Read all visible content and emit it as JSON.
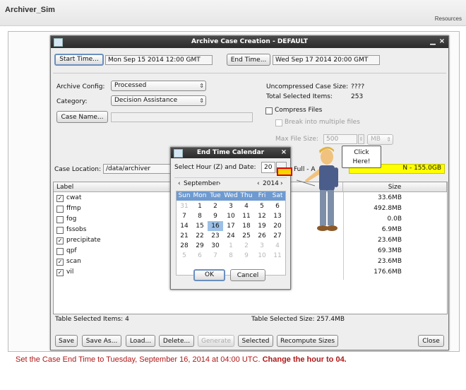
{
  "app": {
    "title": "Archiver_Sim",
    "resources_link": "Resources"
  },
  "window": {
    "title": "Archive Case Creation - DEFAULT",
    "close_symbol": "×"
  },
  "time_range": {
    "start_label": "Start Time...",
    "start_value": "Mon Sep 15 2014 12:00 GMT",
    "end_label": "End Time...",
    "end_value": "Wed Sep 17 2014 20:00 GMT"
  },
  "config": {
    "archive_config_label": "Archive Config:",
    "archive_config_value": "Processed",
    "category_label": "Category:",
    "category_value": "Decision Assistance",
    "case_name_button": "Case Name...",
    "case_name_value": ""
  },
  "summary": {
    "uncompressed_label": "Uncompressed Case Size:",
    "uncompressed_value": "????",
    "total_items_label": "Total Selected Items:",
    "total_items_value": "253",
    "compress_label": "Compress Files",
    "break_label": "Break into multiple files",
    "max_size_label": "Max File Size:",
    "max_size_value": "500",
    "max_size_unit": "MB"
  },
  "location": {
    "label": "Case Location:",
    "value": "/data/archiver",
    "status_prefix": "Full - A",
    "status_text": "N - 155.0GB"
  },
  "table": {
    "headers": {
      "label": "Label",
      "size": "Size"
    },
    "rows": [
      {
        "label": "cwat",
        "checked": true,
        "size": "33.6MB"
      },
      {
        "label": "ffmp",
        "checked": false,
        "size": "492.8MB"
      },
      {
        "label": "fog",
        "checked": false,
        "size": "0.0B"
      },
      {
        "label": "fssobs",
        "checked": false,
        "size": "6.9MB"
      },
      {
        "label": "precipitate",
        "checked": true,
        "size": "23.6MB"
      },
      {
        "label": "qpf",
        "checked": false,
        "size": "69.3MB"
      },
      {
        "label": "scan",
        "checked": true,
        "size": "23.6MB"
      },
      {
        "label": "vil",
        "checked": true,
        "size": "176.6MB"
      }
    ],
    "selected_items_label": "Table Selected Items: 4",
    "selected_size_label": "Table Selected Size: 257.4MB"
  },
  "toolbar": {
    "save": "Save",
    "save_as": "Save As...",
    "load": "Load...",
    "delete": "Delete...",
    "generate": "Generate",
    "selected": "Selected",
    "recompute": "Recompute Sizes",
    "close": "Close"
  },
  "calendar": {
    "title": "End Time Calendar",
    "hour_label": "Select Hour (Z) and Date:",
    "hour_value": "20",
    "month": "September",
    "year": "2014",
    "prev_symbol": "‹",
    "next_symbol": "›",
    "day_headers": [
      "Sun",
      "Mon",
      "Tue",
      "Wed",
      "Thu",
      "Fri",
      "Sat"
    ],
    "days": [
      [
        "31",
        "1",
        "2",
        "3",
        "4",
        "5",
        "6"
      ],
      [
        "7",
        "8",
        "9",
        "10",
        "11",
        "12",
        "13"
      ],
      [
        "14",
        "15",
        "16",
        "17",
        "18",
        "19",
        "20"
      ],
      [
        "21",
        "22",
        "23",
        "24",
        "25",
        "26",
        "27"
      ],
      [
        "28",
        "29",
        "30",
        "1",
        "2",
        "3",
        "4"
      ],
      [
        "5",
        "6",
        "7",
        "8",
        "9",
        "10",
        "11"
      ]
    ],
    "selected_day": "16",
    "ok": "OK",
    "cancel": "Cancel"
  },
  "callout": {
    "line1": "Click",
    "line2": "Here!"
  },
  "instruction": {
    "text": "Set the Case End Time to Tuesday, September 16, 2014 at 04:00 UTC.",
    "emphasis": "Change the hour to 04."
  },
  "colors": {
    "title_bar": "#2b2b2b",
    "calendar_header": "#6e9ad0",
    "selected_day": "#9cc0e6",
    "instruction": "#b01818",
    "highlight": "#e00000"
  }
}
